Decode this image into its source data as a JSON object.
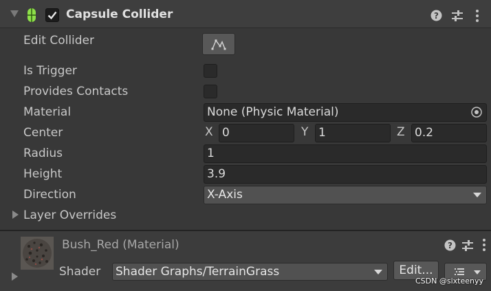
{
  "component": {
    "title": "Capsule Collider",
    "enabled": true,
    "icon": "capsule-collider-icon",
    "header_icons": [
      "help-icon",
      "preset-icon",
      "more-icon"
    ]
  },
  "fields": {
    "edit_collider": {
      "label": "Edit Collider",
      "icon": "edit-collider-icon"
    },
    "is_trigger": {
      "label": "Is Trigger",
      "checked": false
    },
    "provides_contacts": {
      "label": "Provides Contacts",
      "checked": false
    },
    "material": {
      "label": "Material",
      "value": "None (Physic Material)",
      "icon": "object-picker-icon"
    },
    "center": {
      "label": "Center",
      "x_label": "X",
      "x": "0",
      "y_label": "Y",
      "y": "1",
      "z_label": "Z",
      "z": "0.2"
    },
    "radius": {
      "label": "Radius",
      "value": "1"
    },
    "height": {
      "label": "Height",
      "value": "3.9"
    },
    "direction": {
      "label": "Direction",
      "value": "X-Axis"
    },
    "layer_overrides": {
      "label": "Layer Overrides",
      "expanded": false
    }
  },
  "material_section": {
    "title": "Bush_Red (Material)",
    "shader_label": "Shader",
    "shader_value": "Shader Graphs/TerrainGrass",
    "edit_label": "Edit...",
    "icons": [
      "help-icon",
      "preset-icon",
      "more-icon",
      "list-icon"
    ]
  },
  "watermark": "CSDN @sixteenyy",
  "colors": {
    "background": "#383838",
    "header_background": "#3e3e3e",
    "field_background": "#2a2a2a",
    "capsule_icon": "#8ee04a"
  }
}
